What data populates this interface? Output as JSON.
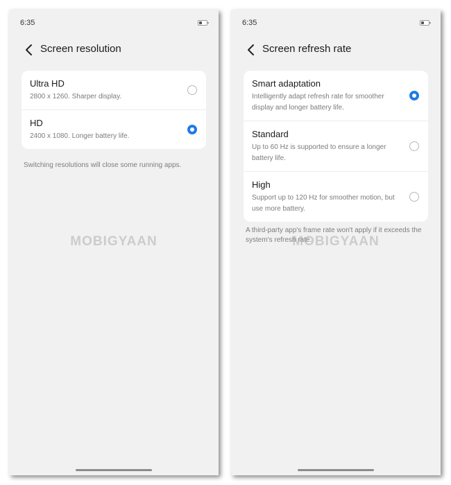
{
  "watermark": "MOBIGYAAN",
  "accent_color": "#1e7ce4",
  "left": {
    "status": {
      "time": "6:35",
      "battery_icon": "battery-icon"
    },
    "title": "Screen resolution",
    "options": [
      {
        "title": "Ultra HD",
        "desc": "2800 x 1260. Sharper display.",
        "selected": false
      },
      {
        "title": "HD",
        "desc": "2400 x 1080. Longer battery life.",
        "selected": true
      }
    ],
    "note": "Switching resolutions will close some running apps."
  },
  "right": {
    "status": {
      "time": "6:35",
      "battery_icon": "battery-icon"
    },
    "title": "Screen refresh rate",
    "options": [
      {
        "title": "Smart adaptation",
        "desc": "Intelligently adapt refresh rate for smoother display and longer battery life.",
        "selected": true
      },
      {
        "title": "Standard",
        "desc": "Up to 60 Hz is supported to ensure a longer battery life.",
        "selected": false
      },
      {
        "title": "High",
        "desc": "Support up to 120 Hz for smoother motion, but use more battery.",
        "selected": false
      }
    ],
    "note": "A third-party app's frame rate won't apply if it exceeds the system's refresh rate."
  }
}
